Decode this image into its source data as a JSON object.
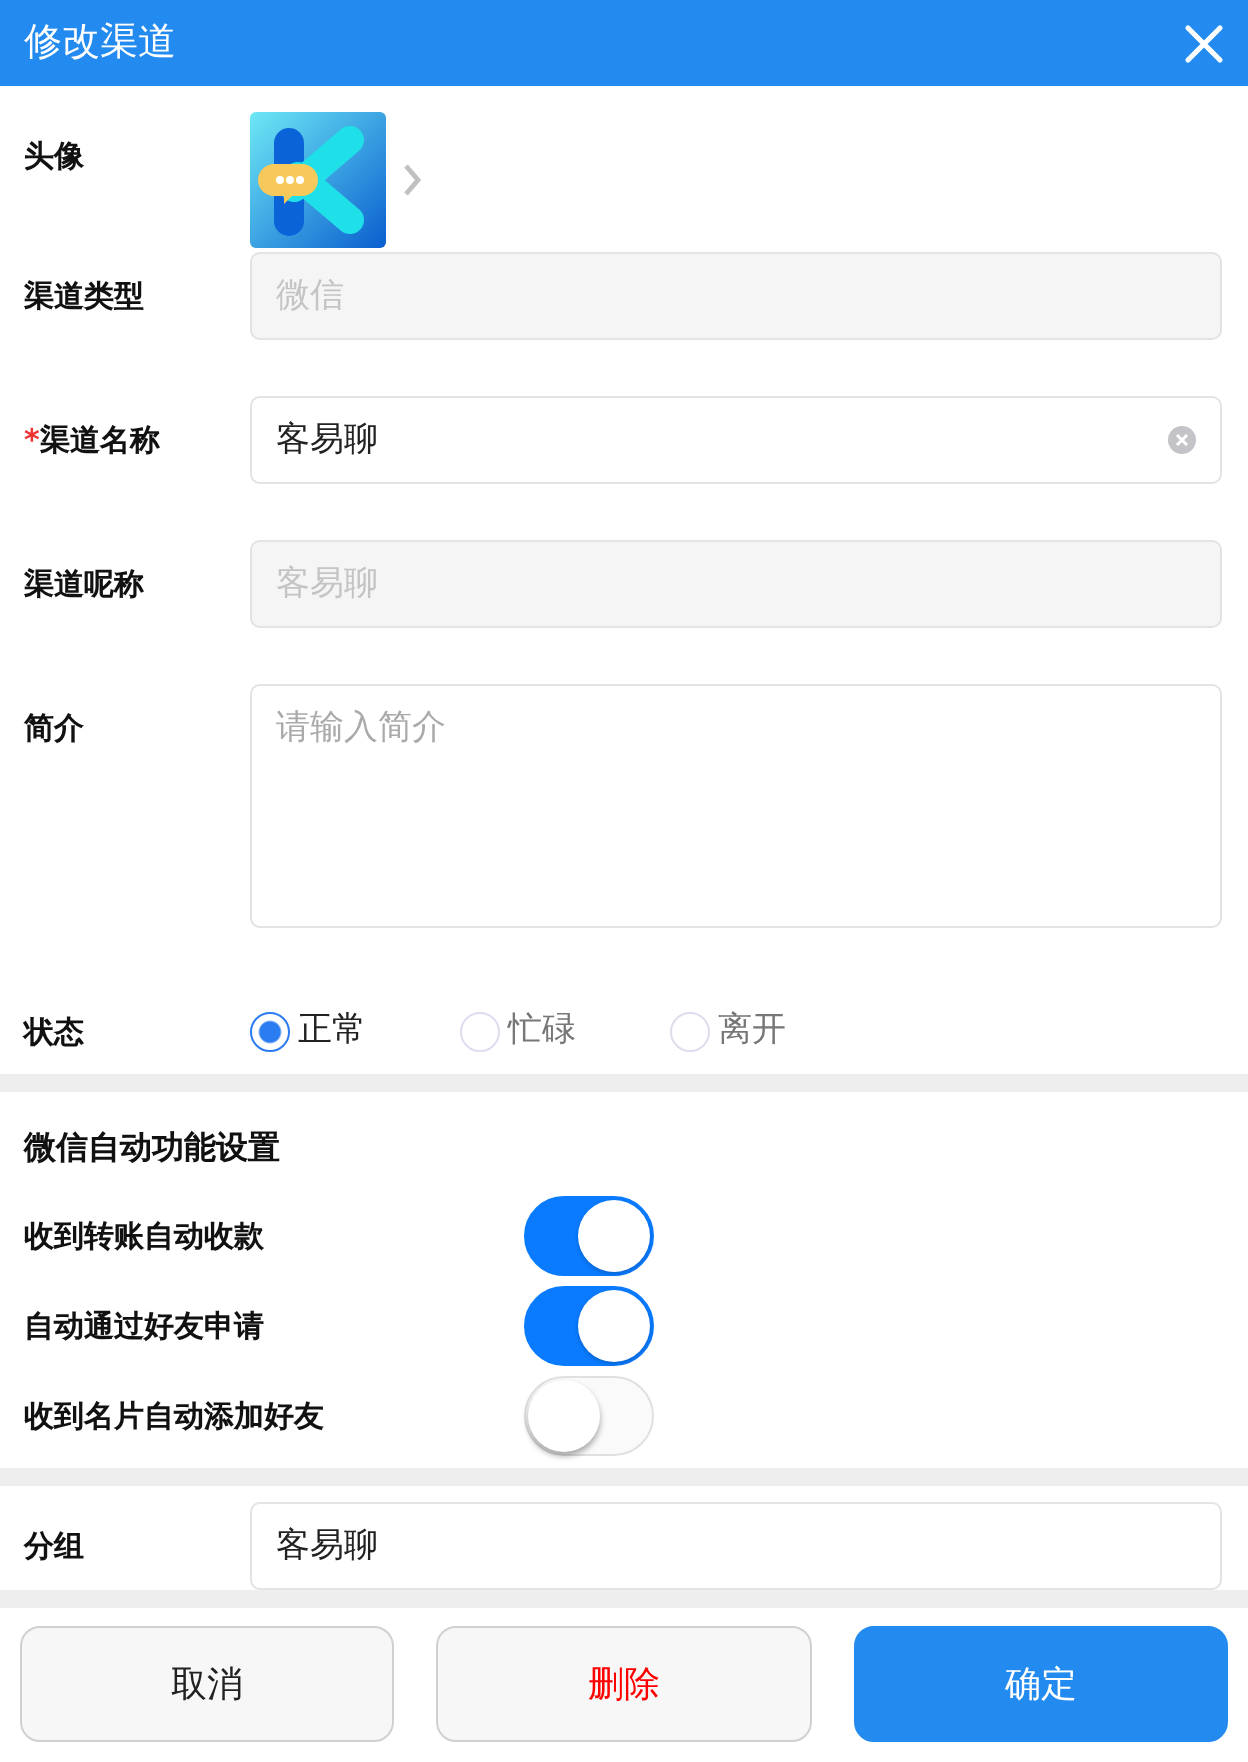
{
  "header": {
    "title": "修改渠道"
  },
  "fields": [
    {
      "kind": "avatar",
      "label": "头像"
    },
    {
      "kind": "input",
      "label": "渠道类型",
      "value": "微信",
      "disabled": true
    },
    {
      "kind": "input",
      "label": "渠道名称",
      "required_mark": "*",
      "value": "客易聊",
      "disabled": false,
      "clearable": true
    },
    {
      "kind": "input",
      "label": "渠道呢称",
      "value": "客易聊",
      "disabled": true
    },
    {
      "kind": "textarea",
      "label": "简介",
      "placeholder": "请输入简介"
    },
    {
      "kind": "radio",
      "label": "状态",
      "options": [
        {
          "label": "正常",
          "selected": true
        },
        {
          "label": "忙碌",
          "selected": false
        },
        {
          "label": "离开",
          "selected": false
        }
      ]
    }
  ],
  "auto_settings": {
    "title": "微信自动功能设置",
    "switches": [
      {
        "label": "收到转账自动收款",
        "on": true
      },
      {
        "label": "自动通过好友申请",
        "on": true
      },
      {
        "label": "收到名片自动添加好友",
        "on": false
      }
    ]
  },
  "group": {
    "label": "分组",
    "value": "客易聊"
  },
  "buttons": [
    {
      "label": "取消",
      "kind": "default"
    },
    {
      "label": "删除",
      "kind": "danger"
    },
    {
      "label": "确定",
      "kind": "primary"
    }
  ]
}
